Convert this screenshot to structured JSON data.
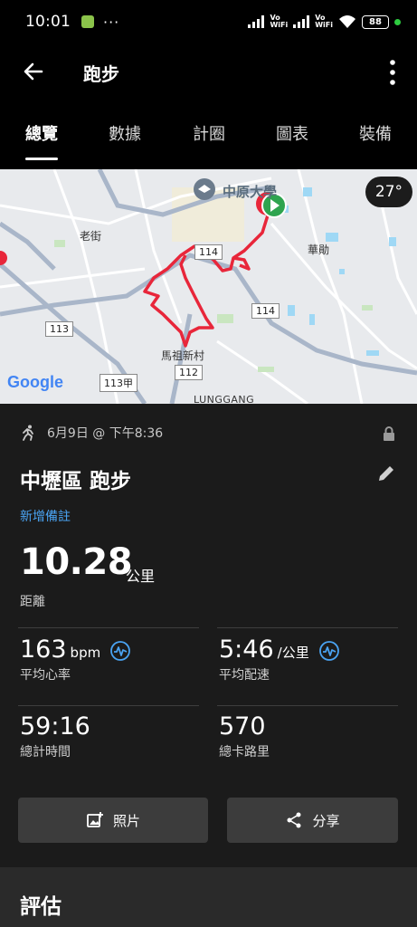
{
  "status_bar": {
    "time": "10:01",
    "dots": "···",
    "wifi_label_1": "Vo\nWiFi",
    "wifi_label_2": "Vo\nWiFi",
    "battery": "88"
  },
  "header": {
    "title": "跑步"
  },
  "tabs": [
    "總覽",
    "數據",
    "計圈",
    "圖表",
    "裝備"
  ],
  "map": {
    "labels": {
      "university": "中原大學",
      "old_street": "老街",
      "huaxun": "華勛",
      "mazu_village": "馬祖新村",
      "lunggang": "LUNGGANG",
      "google": "Google"
    },
    "road_numbers": [
      "114",
      "114",
      "113",
      "113甲",
      "112"
    ],
    "temperature": "27°"
  },
  "activity": {
    "date": "6月9日 @ 下午8:36",
    "title": "中壢區 跑步",
    "add_note": "新增備註",
    "distance": {
      "value": "10.28",
      "unit": "公里",
      "label": "距離"
    },
    "stats": [
      {
        "value": "163",
        "unit": "bpm",
        "label": "平均心率"
      },
      {
        "value": "5:46",
        "unit": "/公里",
        "label": "平均配速"
      },
      {
        "value": "59:16",
        "unit": "",
        "label": "總計時間"
      },
      {
        "value": "570",
        "unit": "",
        "label": "總卡路里"
      }
    ]
  },
  "buttons": {
    "photos": "照片",
    "share": "分享"
  },
  "evaluation": {
    "title": "評估"
  }
}
